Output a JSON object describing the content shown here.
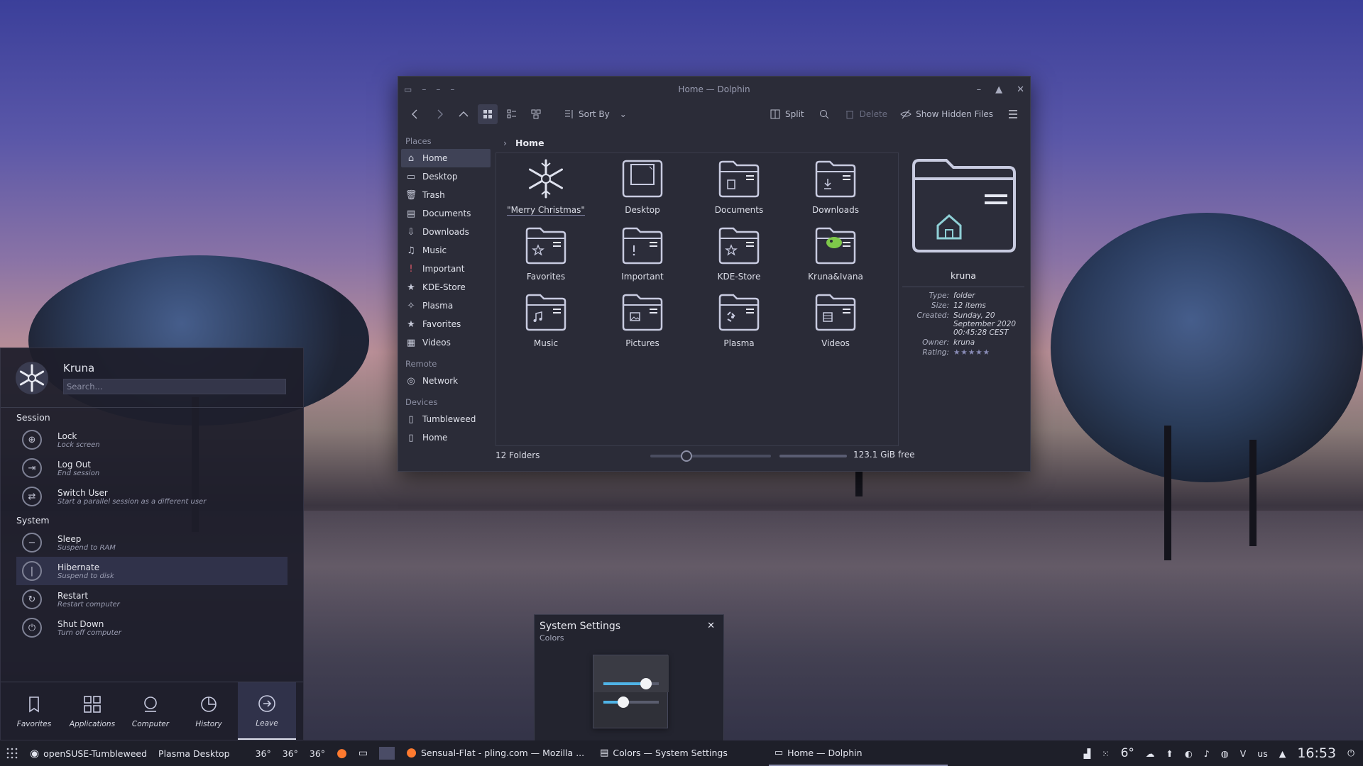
{
  "colors": {
    "accent": "#3f4256",
    "window_bg": "#2b2c38",
    "panel_bg": "#1e1f29"
  },
  "dolphin": {
    "title": "Home — Dolphin",
    "toolbar": {
      "sort_by": "Sort By",
      "split": "Split",
      "delete": "Delete",
      "show_hidden": "Show Hidden Files"
    },
    "places": {
      "header_places": "Places",
      "items": [
        {
          "label": "Home",
          "icon": "home-icon"
        },
        {
          "label": "Desktop",
          "icon": "desktop-icon"
        },
        {
          "label": "Trash",
          "icon": "trash-icon"
        },
        {
          "label": "Documents",
          "icon": "documents-icon"
        },
        {
          "label": "Downloads",
          "icon": "downloads-icon"
        },
        {
          "label": "Music",
          "icon": "music-icon"
        },
        {
          "label": "Important",
          "icon": "important-icon"
        },
        {
          "label": "KDE-Store",
          "icon": "star-icon"
        },
        {
          "label": "Plasma",
          "icon": "plasma-icon"
        },
        {
          "label": "Favorites",
          "icon": "star-icon"
        },
        {
          "label": "Videos",
          "icon": "videos-icon"
        }
      ],
      "header_remote": "Remote",
      "remote": [
        {
          "label": "Network",
          "icon": "network-icon"
        }
      ],
      "header_devices": "Devices",
      "devices": [
        {
          "label": "Tumbleweed",
          "icon": "drive-icon"
        },
        {
          "label": "Home",
          "icon": "drive-icon"
        }
      ]
    },
    "breadcrumb": "Home",
    "files": [
      {
        "name": "\"Merry Christmas\"",
        "icon": "snowflake-icon"
      },
      {
        "name": "Desktop",
        "icon": "desktop-folder-icon"
      },
      {
        "name": "Documents",
        "icon": "documents-folder-icon"
      },
      {
        "name": "Downloads",
        "icon": "downloads-folder-icon"
      },
      {
        "name": "Favorites",
        "icon": "favorites-folder-icon"
      },
      {
        "name": "Important",
        "icon": "important-folder-icon"
      },
      {
        "name": "KDE-Store",
        "icon": "kde-store-folder-icon"
      },
      {
        "name": "Kruna&Ivana",
        "icon": "kruna-ivana-folder-icon"
      },
      {
        "name": "Music",
        "icon": "music-folder-icon"
      },
      {
        "name": "Pictures",
        "icon": "pictures-folder-icon"
      },
      {
        "name": "Plasma",
        "icon": "plasma-folder-icon"
      },
      {
        "name": "Videos",
        "icon": "videos-folder-icon"
      }
    ],
    "status": {
      "folders": "12 Folders",
      "free": "123.1 GiB free",
      "zoom_fraction": 0.25
    },
    "info": {
      "name": "kruna",
      "type_label": "Type:",
      "type": "folder",
      "size_label": "Size:",
      "size": "12 items",
      "created_label": "Created:",
      "created": "Sunday, 20 September 2020 00:45:28 CEST",
      "owner_label": "Owner:",
      "owner": "kruna",
      "rating_label": "Rating:",
      "rating": "★★★★★"
    }
  },
  "kickoff": {
    "user": "Kruna",
    "search_placeholder": "Search...",
    "session_header": "Session",
    "session": [
      {
        "title": "Lock",
        "sub": "Lock screen",
        "icon": "lock-icon"
      },
      {
        "title": "Log Out",
        "sub": "End session",
        "icon": "logout-icon"
      },
      {
        "title": "Switch User",
        "sub": "Start a parallel session as a different user",
        "icon": "switch-user-icon"
      }
    ],
    "system_header": "System",
    "system": [
      {
        "title": "Sleep",
        "sub": "Suspend to RAM",
        "icon": "sleep-icon"
      },
      {
        "title": "Hibernate",
        "sub": "Suspend to disk",
        "icon": "hibernate-icon"
      },
      {
        "title": "Restart",
        "sub": "Restart computer",
        "icon": "restart-icon"
      },
      {
        "title": "Shut Down",
        "sub": "Turn off computer",
        "icon": "shutdown-icon"
      }
    ],
    "tabs": [
      "Favorites",
      "Applications",
      "Computer",
      "History",
      "Leave"
    ]
  },
  "osd": {
    "title": "System Settings",
    "subtitle": "Colors",
    "close": "✕"
  },
  "taskbar": {
    "activity": "openSUSE-Tumbleweed",
    "desktop": "Plasma Desktop",
    "temps": [
      "36°",
      "36°",
      "36°"
    ],
    "tasks": [
      "Sensual-Flat - pling.com — Mozilla ...",
      "Colors — System Settings",
      "Home — Dolphin"
    ],
    "weather": "6°",
    "keyboard": "us",
    "clock": "16:53"
  }
}
